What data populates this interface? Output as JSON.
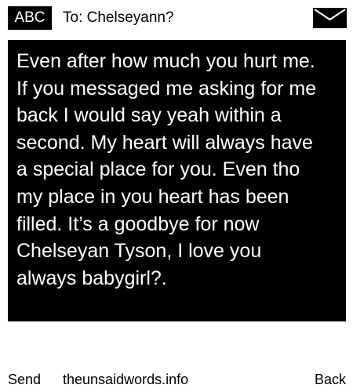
{
  "header": {
    "mode_label": "ABC",
    "recipient": "To: Chelseyann?",
    "envelope_icon": "envelope-icon"
  },
  "message": {
    "text": "Even after how much you hurt me.\nIf you messaged me asking for me\nback I would say yeah within a\nsecond. My heart will always have\na special place for you. Even tho\nmy place in you heart has been\nfilled. It’s a goodbye for now\nChelseyan Tyson, I love you\nalways babygirl?."
  },
  "footer": {
    "send_label": "Send",
    "site_label": "theunsaidwords.info",
    "back_label": "Back"
  },
  "colors": {
    "background": "#ffffff",
    "message_background": "#000000",
    "message_text": "#ffffff",
    "text": "#000000"
  }
}
